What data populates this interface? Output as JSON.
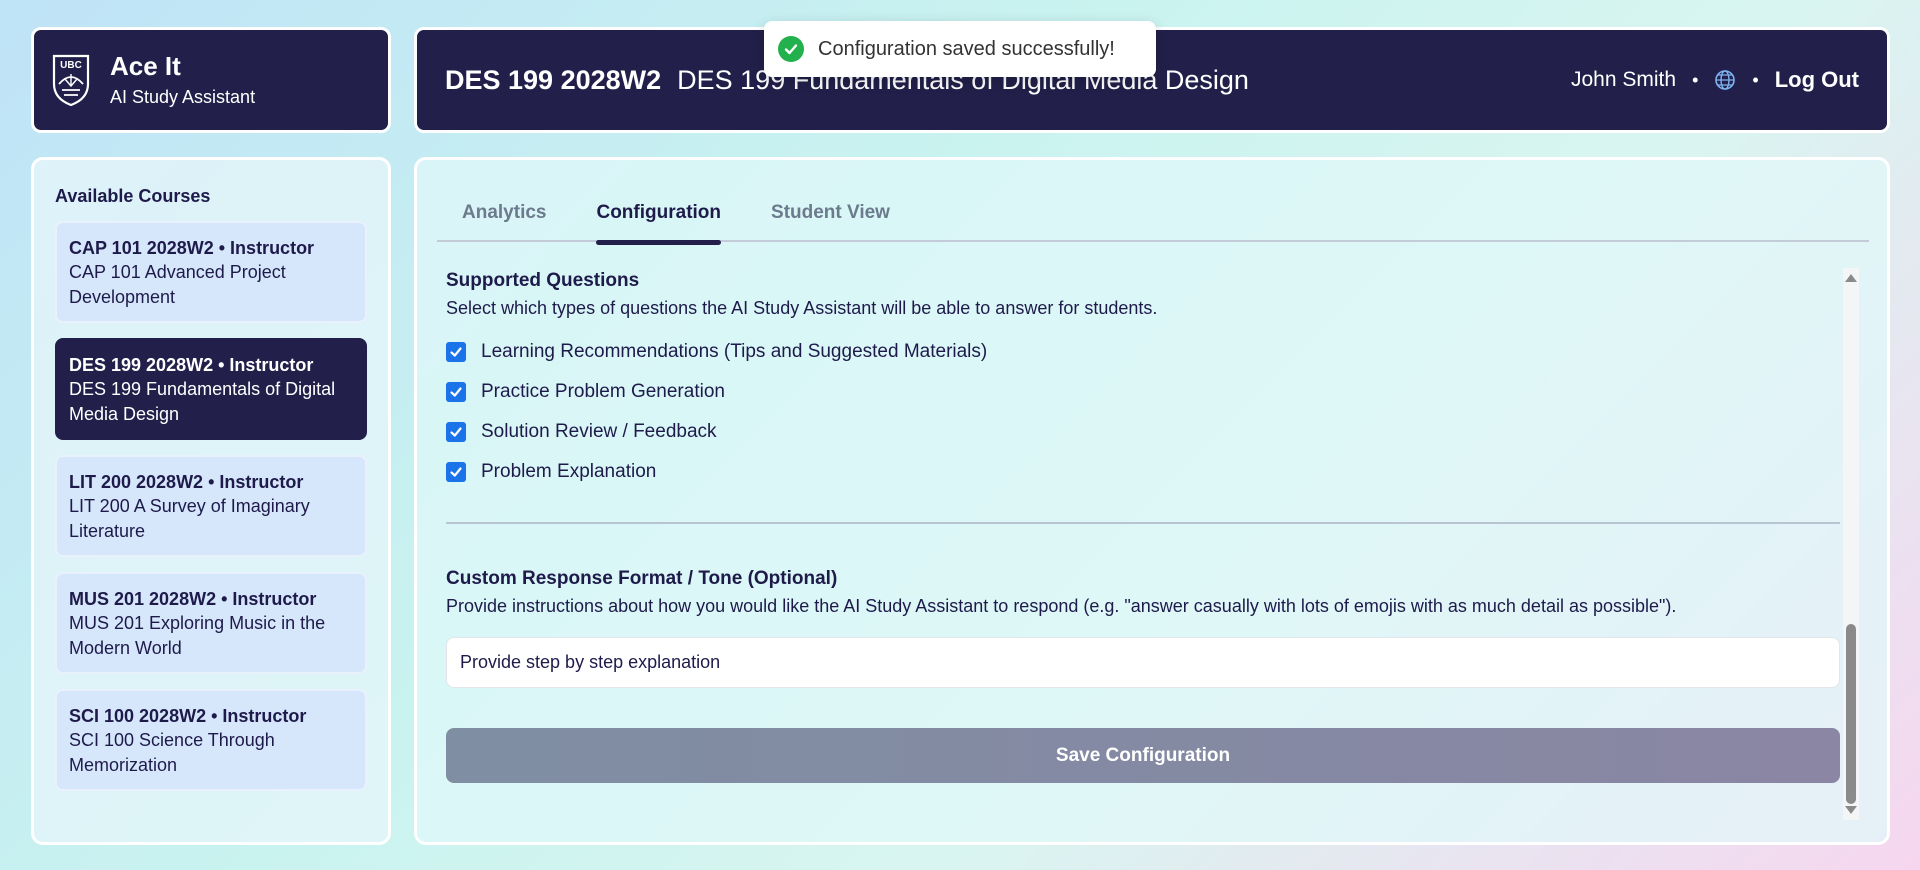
{
  "brand": {
    "title": "Ace It",
    "subtitle": "AI Study Assistant",
    "logo_text": "UBC"
  },
  "header": {
    "course_code": "DES 199 2028W2",
    "course_name": "DES 199 Fundamentals of Digital Media Design",
    "user_name": "John Smith",
    "separator": "•",
    "logout_label": "Log Out"
  },
  "toast": {
    "message": "Configuration saved successfully!"
  },
  "sidebar": {
    "heading": "Available Courses",
    "courses": [
      {
        "code": "CAP 101 2028W2 • Instructor",
        "name": "CAP 101 Advanced Project Development",
        "active": false
      },
      {
        "code": "DES 199 2028W2 • Instructor",
        "name": "DES 199 Fundamentals of Digital Media Design",
        "active": true
      },
      {
        "code": "LIT 200 2028W2 • Instructor",
        "name": "LIT 200 A Survey of Imaginary Literature",
        "active": false
      },
      {
        "code": "MUS 201 2028W2 • Instructor",
        "name": "MUS 201 Exploring Music in the Modern World",
        "active": false
      },
      {
        "code": "SCI 100 2028W2 • Instructor",
        "name": "SCI 100 Science Through Memorization",
        "active": false
      }
    ]
  },
  "tabs": [
    {
      "label": "Analytics",
      "active": false
    },
    {
      "label": "Configuration",
      "active": true
    },
    {
      "label": "Student View",
      "active": false
    }
  ],
  "supported_questions": {
    "title": "Supported Questions",
    "description": "Select which types of questions the AI Study Assistant will be able to answer for students.",
    "options": [
      {
        "label": "Learning Recommendations (Tips and Suggested Materials)",
        "checked": true
      },
      {
        "label": "Practice Problem Generation",
        "checked": true
      },
      {
        "label": "Solution Review / Feedback",
        "checked": true
      },
      {
        "label": "Problem Explanation",
        "checked": true
      }
    ]
  },
  "custom_format": {
    "title": "Custom Response Format / Tone (Optional)",
    "description": "Provide instructions about how you would like the AI Study Assistant to respond (e.g. \"answer casually with lots of emojis with as much detail as possible\").",
    "value": "Provide step by step explanation"
  },
  "save_button_label": "Save Configuration",
  "colors": {
    "navy": "#22204a",
    "checkbox": "#1a73e8",
    "success": "#22b14c",
    "card": "#d6e6fb"
  },
  "icons": [
    "ubc-shield-icon",
    "globe-icon",
    "check-circle-icon",
    "checkbox-checked-icon"
  ]
}
